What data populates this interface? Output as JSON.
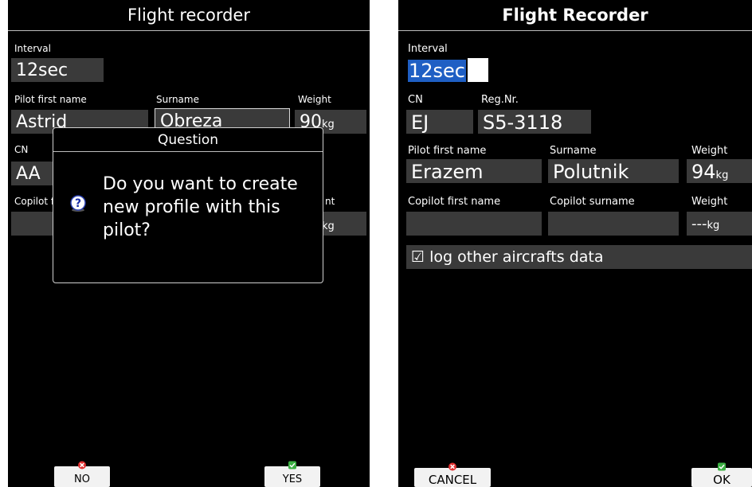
{
  "left": {
    "title": "Flight recorder",
    "interval_label": "Interval",
    "interval_value": "12sec",
    "pilot_first_label": "Pilot first name",
    "pilot_first_value": "Astrid",
    "surname_label": "Surname",
    "surname_value": "Obreza",
    "weight_label": "Weight",
    "weight_value": "90",
    "weight_unit": "kg",
    "cn_label": "CN",
    "cn_value": "AA",
    "copilot_label_partial": "Copilot f",
    "weight2_label_partial": "nt",
    "weight2_unit": "kg",
    "dialog": {
      "title": "Question",
      "message": "Do you want to create new profile with this pilot?",
      "icon": "question-icon"
    },
    "buttons": {
      "no_label": "NO",
      "yes_label": "YES"
    }
  },
  "right": {
    "title": "Flight Recorder",
    "interval_label": "Interval",
    "interval_value": "12sec",
    "cn_label": "CN",
    "cn_value": "EJ",
    "reg_label": "Reg.Nr.",
    "reg_value": "S5-3118",
    "pilot_first_label": "Pilot first name",
    "pilot_first_value": "Erazem",
    "surname_label": "Surname",
    "surname_value": "Polutnik",
    "weight_label": "Weight",
    "weight_value": "94",
    "weight_unit": "kg",
    "copilot_first_label": "Copilot first name",
    "copilot_surname_label": "Copilot surname",
    "copilot_weight_label": "Weight",
    "copilot_weight_value": "---",
    "copilot_weight_unit": "kg",
    "checkbox_label": "☑ log other aircrafts data",
    "buttons": {
      "cancel_label": "CANCEL",
      "ok_label": "OK"
    }
  },
  "colors": {
    "background": "#000000",
    "field": "#3a3a3a",
    "selection": "#1f5fc4",
    "icon_red": "#e03030",
    "icon_green": "#3cb043"
  }
}
